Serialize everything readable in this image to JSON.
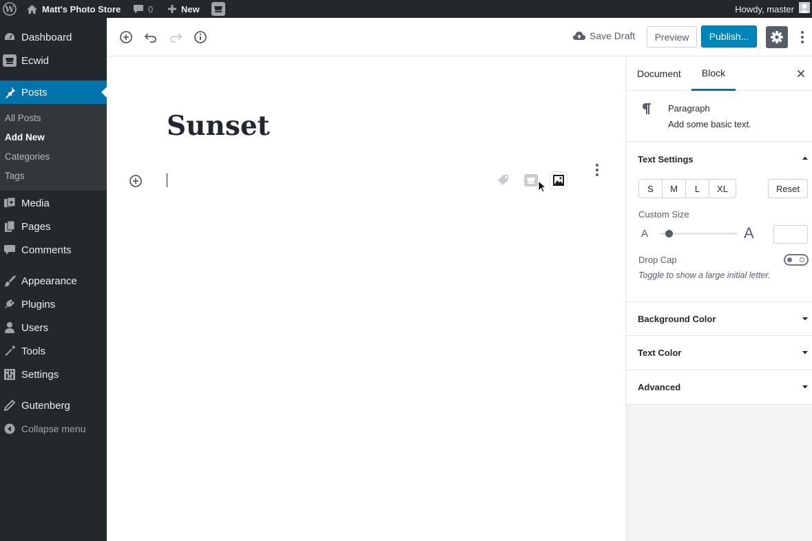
{
  "adminbar": {
    "site_name": "Matt's Photo Store",
    "comments_count": "0",
    "new_label": "New",
    "howdy": "Howdy, master"
  },
  "sidebar": {
    "items": [
      {
        "label": "Dashboard",
        "icon": "dashboard-icon"
      },
      {
        "label": "Ecwid",
        "icon": "cart-icon"
      },
      {
        "label": "Posts",
        "icon": "pin-icon",
        "active": true
      },
      {
        "label": "Media",
        "icon": "media-icon"
      },
      {
        "label": "Pages",
        "icon": "pages-icon"
      },
      {
        "label": "Comments",
        "icon": "comments-icon"
      },
      {
        "label": "Appearance",
        "icon": "brush-icon"
      },
      {
        "label": "Plugins",
        "icon": "plugin-icon"
      },
      {
        "label": "Users",
        "icon": "users-icon"
      },
      {
        "label": "Tools",
        "icon": "wrench-icon"
      },
      {
        "label": "Settings",
        "icon": "settings-icon"
      },
      {
        "label": "Gutenberg",
        "icon": "pencil-icon"
      }
    ],
    "submenu": [
      {
        "label": "All Posts"
      },
      {
        "label": "Add New",
        "current": true
      },
      {
        "label": "Categories"
      },
      {
        "label": "Tags"
      }
    ],
    "collapse_label": "Collapse menu"
  },
  "header": {
    "save_draft": "Save Draft",
    "preview": "Preview",
    "publish": "Publish..."
  },
  "editor": {
    "title": "Sunset"
  },
  "settings_panel": {
    "tabs": [
      "Document",
      "Block"
    ],
    "active_tab": "Block",
    "block_card": {
      "title": "Paragraph",
      "description": "Add some basic text."
    },
    "text_settings": {
      "heading": "Text Settings",
      "sizes": [
        "S",
        "M",
        "L",
        "XL"
      ],
      "reset": "Reset",
      "custom_size_label": "Custom Size",
      "range_small": "A",
      "range_large": "A",
      "drop_cap_label": "Drop Cap",
      "drop_cap_help": "Toggle to show a large initial letter."
    },
    "background_color": "Background Color",
    "text_color": "Text Color",
    "advanced": "Advanced"
  },
  "colors": {
    "admin_bg": "#23282d",
    "active": "#0073aa",
    "publish": "#0085ba"
  }
}
